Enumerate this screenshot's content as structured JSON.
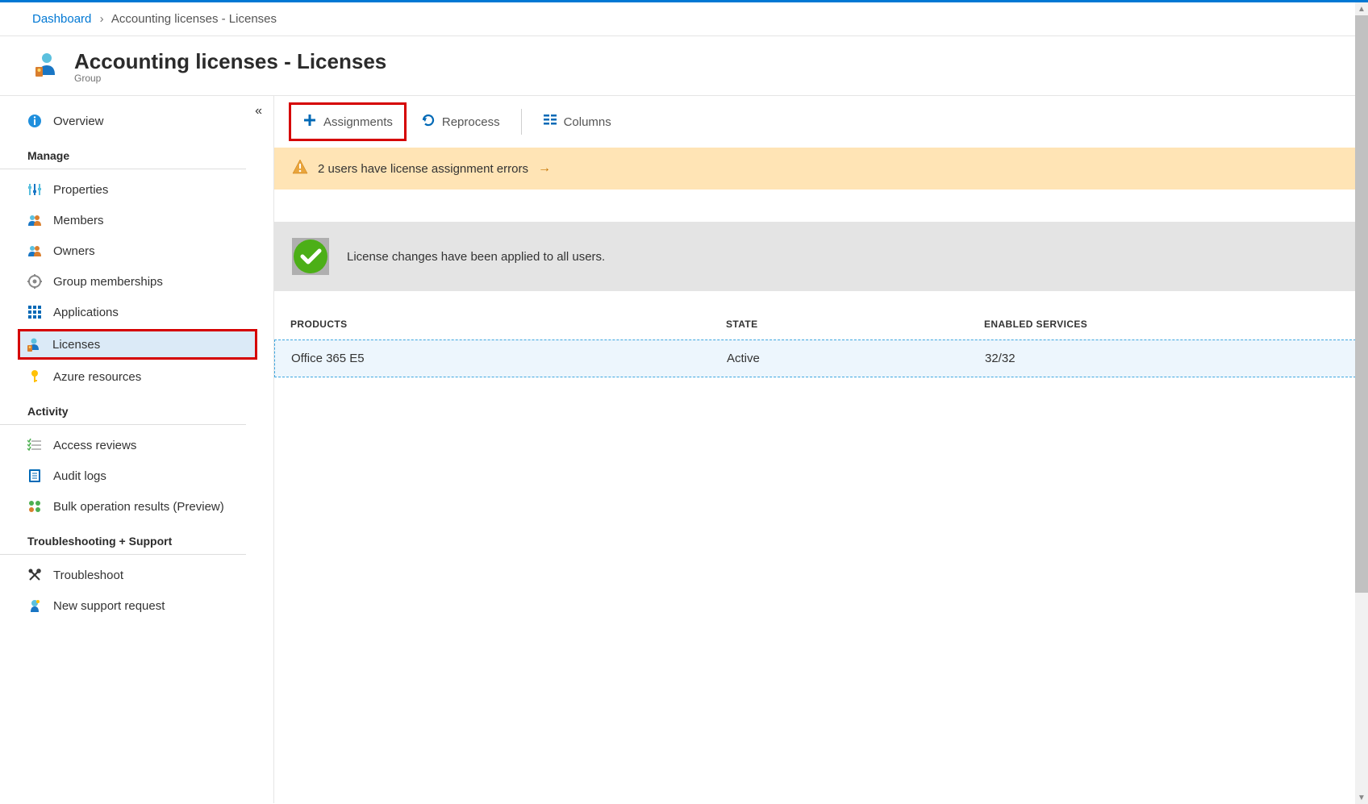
{
  "breadcrumb": {
    "root": "Dashboard",
    "current": "Accounting licenses - Licenses"
  },
  "header": {
    "title": "Accounting licenses - Licenses",
    "subtitle": "Group"
  },
  "sidebar": {
    "overview": "Overview",
    "sections": {
      "manage": {
        "title": "Manage",
        "items": {
          "properties": "Properties",
          "members": "Members",
          "owners": "Owners",
          "group_memberships": "Group memberships",
          "applications": "Applications",
          "licenses": "Licenses",
          "azure_resources": "Azure resources"
        }
      },
      "activity": {
        "title": "Activity",
        "items": {
          "access_reviews": "Access reviews",
          "audit_logs": "Audit logs",
          "bulk_operation_results": "Bulk operation results (Preview)"
        }
      },
      "troubleshooting": {
        "title": "Troubleshooting + Support",
        "items": {
          "troubleshoot": "Troubleshoot",
          "new_support_request": "New support request"
        }
      }
    }
  },
  "toolbar": {
    "assignments": "Assignments",
    "reprocess": "Reprocess",
    "columns": "Columns"
  },
  "warning": {
    "text": "2 users have license assignment errors"
  },
  "status": {
    "text": "License changes have been applied to all users."
  },
  "table": {
    "headers": {
      "products": "PRODUCTS",
      "state": "STATE",
      "enabled_services": "ENABLED SERVICES"
    },
    "rows": [
      {
        "product": "Office 365 E5",
        "state": "Active",
        "enabled_services": "32/32"
      }
    ]
  }
}
